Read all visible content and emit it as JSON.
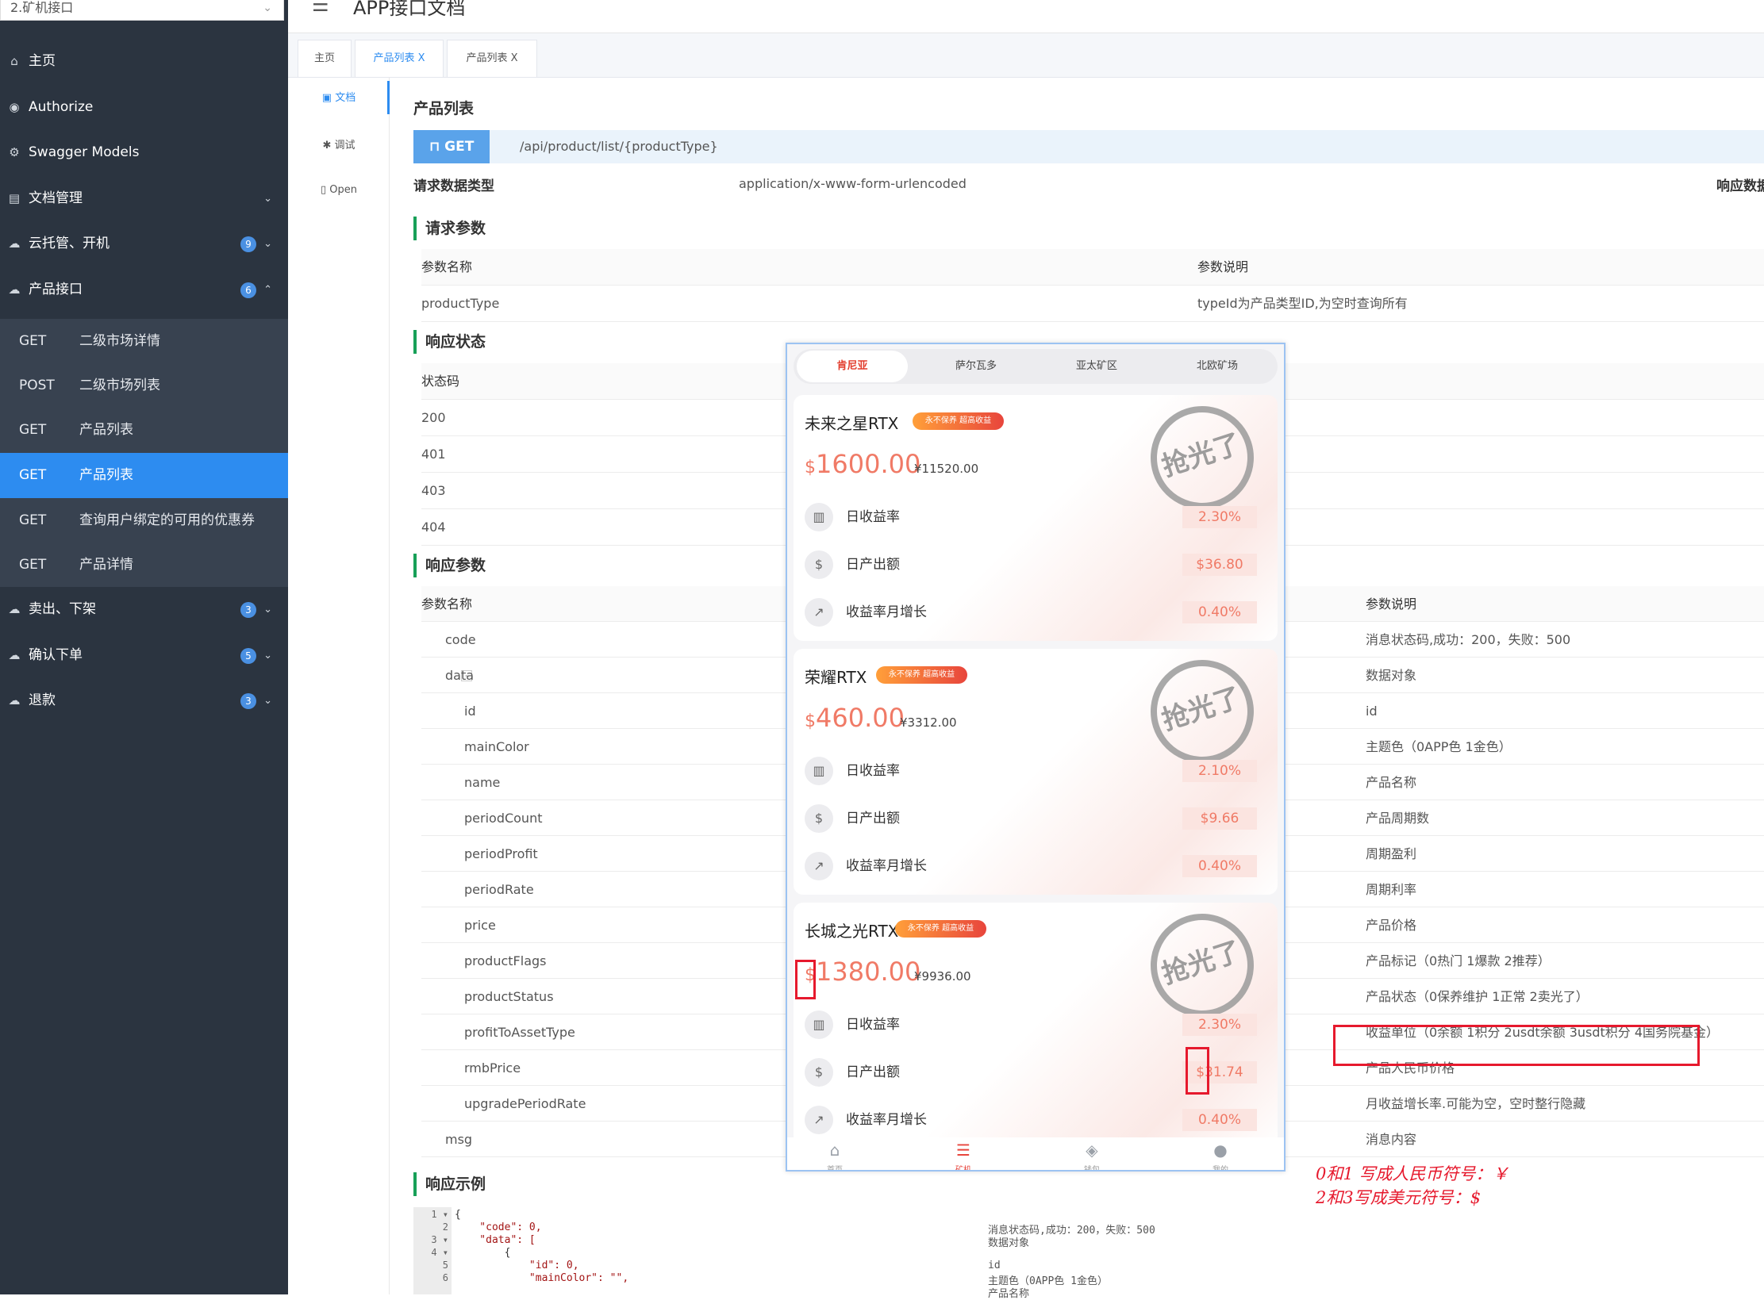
{
  "sidebar": {
    "project_select": "2.矿机接口",
    "items": [
      {
        "label": "主页",
        "icon": "home-icon"
      },
      {
        "label": "Authorize",
        "icon": "lock-icon"
      },
      {
        "label": "Swagger Models",
        "icon": "gear-icon"
      },
      {
        "label": "文档管理",
        "icon": "document-icon"
      },
      {
        "label": "云托管、开机",
        "icon": "cloud-icon",
        "badge": "9"
      },
      {
        "label": "产品接口",
        "icon": "cloud-icon",
        "badge": "6"
      },
      {
        "label": "卖出、下架",
        "icon": "cloud-icon",
        "badge": "3"
      },
      {
        "label": "确认下单",
        "icon": "cloud-icon",
        "badge": "5"
      },
      {
        "label": "退款",
        "icon": "cloud-icon",
        "badge": "3"
      }
    ],
    "sub_items": [
      {
        "method": "GET",
        "label": "二级市场详情"
      },
      {
        "method": "POST",
        "label": "二级市场列表"
      },
      {
        "method": "GET",
        "label": "产品列表"
      },
      {
        "method": "GET",
        "label": "产品列表"
      },
      {
        "method": "GET",
        "label": "查询用户绑定的可用的优惠券"
      },
      {
        "method": "GET",
        "label": "产品详情"
      }
    ]
  },
  "header": {
    "title": "APP接口文档"
  },
  "tabs": [
    {
      "label": "主页"
    },
    {
      "label": "产品列表",
      "close": "X"
    },
    {
      "label": "产品列表",
      "close": "X"
    }
  ],
  "docnav": [
    {
      "label": "文档",
      "icon": "doc-icon"
    },
    {
      "label": "调试",
      "icon": "bug-icon"
    },
    {
      "label": "Open",
      "icon": "file-icon"
    }
  ],
  "api": {
    "title": "产品列表",
    "method": "GET",
    "path": "/api/product/list/{productType}",
    "req_type_label": "请求数据类型",
    "req_type": "application/x-www-form-urlencoded",
    "resp_type_label": "响应数据"
  },
  "request_params": {
    "section": "请求参数",
    "headers": [
      "参数名称",
      "参数说明"
    ],
    "rows": [
      {
        "name": "productType",
        "desc": "typeId为产品类型ID,为空时查询所有"
      }
    ]
  },
  "response_status": {
    "section": "响应状态",
    "header": "状态码",
    "codes": [
      "200",
      "401",
      "403",
      "404"
    ]
  },
  "response_params": {
    "section": "响应参数",
    "headers": [
      "参数名称",
      "参数说明"
    ],
    "rows": [
      {
        "name": "code",
        "desc": "消息状态码,成功：200，失败：500"
      },
      {
        "name": "data",
        "desc": "数据对象",
        "toggle": "-"
      },
      {
        "name": "id",
        "desc": "id"
      },
      {
        "name": "mainColor",
        "desc": "主题色（0APP色 1金色）"
      },
      {
        "name": "name",
        "desc": "产品名称"
      },
      {
        "name": "periodCount",
        "desc": "产品周期数"
      },
      {
        "name": "periodProfit",
        "desc": "周期盈利"
      },
      {
        "name": "periodRate",
        "desc": "周期利率"
      },
      {
        "name": "price",
        "desc": "产品价格"
      },
      {
        "name": "productFlags",
        "desc": "产品标记（0热门 1爆款 2推荐）"
      },
      {
        "name": "productStatus",
        "desc": "产品状态（0保养维护 1正常 2卖光了）"
      },
      {
        "name": "profitToAssetType",
        "desc": "收益单位（0余额 1积分 2usdt余额 3usdt积分 4国务院基金）"
      },
      {
        "name": "rmbPrice",
        "desc": "产品人民币价格"
      },
      {
        "name": "upgradePeriodRate",
        "desc": "月收益增长率.可能为空，空时整行隐藏"
      },
      {
        "name": "msg",
        "desc": "消息内容"
      }
    ]
  },
  "response_example": {
    "section": "响应示例",
    "lines": [
      "{",
      "    \"code\": 0,",
      "    \"data\": [",
      "        {",
      "            \"id\": 0,",
      "            \"mainColor\": \"\","
    ],
    "comments": [
      "消息状态码,成功：200，失败：500",
      "数据对象",
      "",
      "id",
      "主题色（0APP色 1金色）",
      "产品名称"
    ]
  },
  "phone": {
    "tabs": [
      "肯尼亚",
      "萨尔瓦多",
      "亚太矿区",
      "北欧矿场"
    ],
    "cards": [
      {
        "name": "未来之星RTX",
        "tag": "永不保养 超高收益",
        "currency": "$",
        "price": "1600.00",
        "rmb": "¥11520.00",
        "stamp": "抢光了",
        "stats": [
          {
            "label": "日收益率",
            "value": "2.30%"
          },
          {
            "label": "日产出额",
            "value": "$36.80"
          },
          {
            "label": "收益率月增长",
            "value": "0.40%"
          }
        ]
      },
      {
        "name": "荣耀RTX",
        "tag": "永不保养 超高收益",
        "currency": "$",
        "price": "460.00",
        "rmb": "¥3312.00",
        "stamp": "抢光了",
        "stats": [
          {
            "label": "日收益率",
            "value": "2.10%"
          },
          {
            "label": "日产出额",
            "value": "$9.66"
          },
          {
            "label": "收益率月增长",
            "value": "0.40%"
          }
        ]
      },
      {
        "name": "长城之光RTX",
        "tag": "永不保养 超高收益",
        "currency": "$",
        "price": "1380.00",
        "rmb": "¥9936.00",
        "stamp": "抢光了",
        "stats": [
          {
            "label": "日收益率",
            "value": "2.30%"
          },
          {
            "label": "日产出额",
            "value": "$31.74"
          },
          {
            "label": "收益率月增长",
            "value": "0.40%"
          }
        ]
      }
    ],
    "nav": [
      "首页",
      "矿机",
      "钱包",
      "我的"
    ]
  },
  "annotation": {
    "line1": "0和1 写成人民币符号：￥",
    "line2": "2和3写成美元符号：$",
    "color": "#e6192d"
  }
}
